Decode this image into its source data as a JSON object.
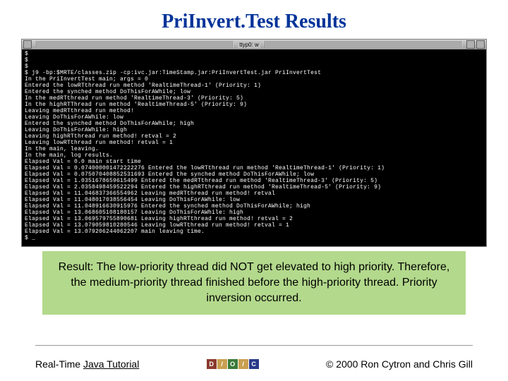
{
  "title": "PriInvert.Test Results",
  "window": {
    "title": "ttyp0: w"
  },
  "terminal": {
    "text": "$\n$\n$\n$ j9 -bp:$MRTE/classes.zip -cp:ivc.jar:TimeStamp.jar:PriInvertTest.jar PriInvertTest\nIn the PriInvertTest main; args = 0\nEntered the lowRTthread run method 'RealtimeThread-1' (Priority: 1)\nEntered the synched method DoThisForAWhile; low\nIn the medRTthread run method 'RealtimeThread-3' (Priority: 5)\nIn the highRTThread run method 'RealtimeThread-5' (Priority: 9)\nLeaving medRTthread run method!\nLeaving DoThisForAWhile: low\nEntered the synched method DoThisForAWhile; high\nLeaving DoThisForAWhile: high\nLeaving highRTthread run method! retval = 2\nLeaving lowRTthread run method! retval = 1\nIn the main, leaving.\nIn the main, log results.\nElapsed Val = 0.0 main start time\nElapsed Val = 0.074000001472222276 Entered the lowRTthread run method 'RealtimeThread-1' (Priority: 1)\nElapsed Val = 0.075070408852531693 Entered the synched method DoThisForAWhile; low\nElapsed Val = 1.0351678659615499 Entered the medRTthread run method 'RealtimeThread-3' (Priority: 5)\nElapsed Val = 2.0358498459522294 Entered the highRTthread run method 'RealtimeThread-5' (Priority: 9)\nElapsed Val = 11.046837366554962 Leaving medRTthread run method! retval\nElapsed Val = 11.048017038556454 Leaving DoThisForAWhile: low\nElapsed Val = 11.048916630915976 Entered the synched method DoThisForAWhile; high\nElapsed Val = 13.068605108180157 Leaving DoThisForAWhile: high\nElapsed Val = 13.069579755890681 Leaving highRTthread run method! retval = 2\nElapsed Val = 13.079059810280546 Leaving lowRTthread run method! retval = 1\nElapsed Val = 13.079206244062207 main leaving time.\n$ _"
  },
  "result": "Result:  The low-priority thread did NOT get elevated to high priority.  Therefore, the medium-priority thread finished before the high-priority thread.  Priority inversion occurred.",
  "footer": {
    "left_prefix": "Real-Time ",
    "left_link": "Java ",
    "left_suffix": "Tutorial",
    "right": "2000 Ron Cytron and Chris Gill",
    "copyright": "©",
    "logo": [
      "D",
      "/",
      "O",
      "/",
      "C"
    ]
  }
}
